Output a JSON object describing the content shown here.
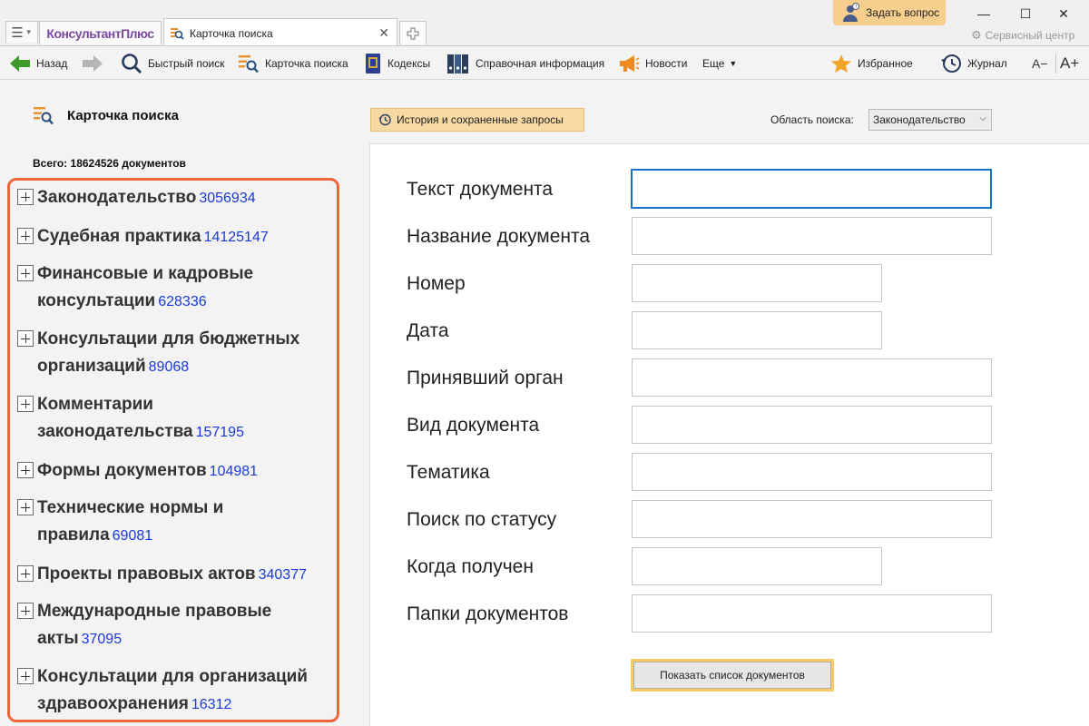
{
  "window": {
    "brand": "КонсультантПлюс",
    "tab_title": "Карточка поиска",
    "ask_label": "Задать вопрос",
    "service_center": "Сервисный центр",
    "controls": {
      "minimize": "—",
      "maximize": "☐",
      "close": "✕"
    }
  },
  "toolbar": {
    "back": "Назад",
    "quick_search": "Быстрый поиск",
    "search_card": "Карточка поиска",
    "codes": "Кодексы",
    "reference": "Справочная информация",
    "news": "Новости",
    "more": "Еще",
    "favorites": "Избранное",
    "journal": "Журнал",
    "font_decrease": "A−",
    "font_increase": "A+"
  },
  "left": {
    "title": "Карточка поиска",
    "total": "Всего: 18624526 документов",
    "categories": [
      {
        "line1": "Законодательство",
        "line2": "",
        "count": "3056934"
      },
      {
        "line1": "Судебная практика",
        "line2": "",
        "count": "14125147"
      },
      {
        "line1": "Финансовые и кадровые",
        "line2": "консультации",
        "count": "628336"
      },
      {
        "line1": "Консультации для бюджетных",
        "line2": "организаций",
        "count": "89068"
      },
      {
        "line1": "Комментарии",
        "line2": "законодательства",
        "count": "157195"
      },
      {
        "line1": "Формы документов",
        "line2": "",
        "count": "104981"
      },
      {
        "line1": "Технические нормы и",
        "line2": "правила",
        "count": "69081"
      },
      {
        "line1": "Проекты правовых актов",
        "line2": "",
        "count": "340377"
      },
      {
        "line1": "Международные правовые",
        "line2": "акты",
        "count": "37095"
      },
      {
        "line1": "Консультации для организаций",
        "line2": "здравоохранения",
        "count": "16312"
      }
    ]
  },
  "right": {
    "history_button": "История и сохраненные запросы",
    "area_label": "Область поиска:",
    "area_value": "Законодательство",
    "fields": [
      {
        "label": "Текст документа",
        "value": ""
      },
      {
        "label": "Название документа",
        "value": ""
      },
      {
        "label": "Номер",
        "value": ""
      },
      {
        "label": "Дата",
        "value": ""
      },
      {
        "label": "Принявший орган",
        "value": ""
      },
      {
        "label": "Вид документа",
        "value": ""
      },
      {
        "label": "Тематика",
        "value": ""
      },
      {
        "label": "Поиск по статусу",
        "value": ""
      },
      {
        "label": "Когда получен",
        "value": ""
      },
      {
        "label": "Папки документов",
        "value": ""
      }
    ],
    "show_button": "Показать список документов"
  }
}
